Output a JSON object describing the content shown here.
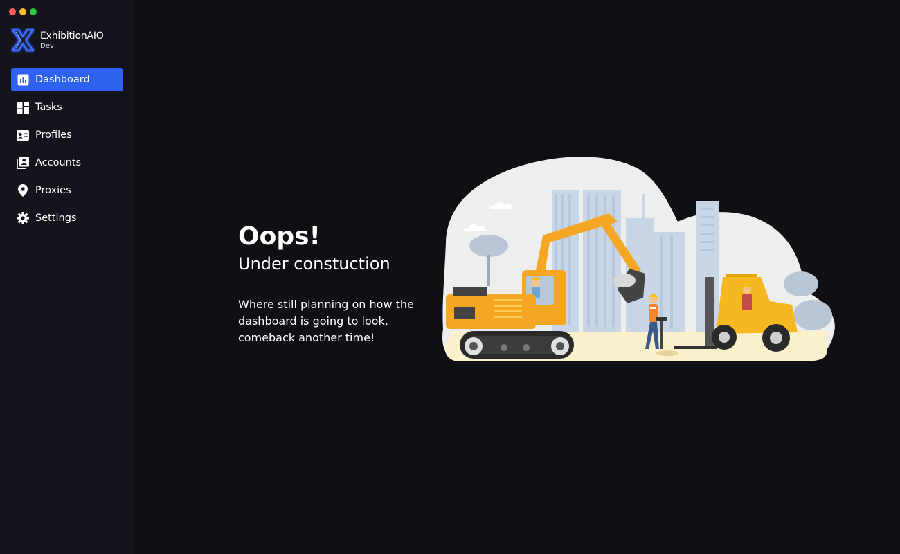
{
  "window": {
    "controls": [
      "close",
      "minimize",
      "zoom"
    ]
  },
  "brand": {
    "name": "ExhibitionAIO",
    "environment": "Dev",
    "logo_icon": "x-logo-icon",
    "accent": "#2f63ef"
  },
  "sidebar": {
    "items": [
      {
        "label": "Dashboard",
        "icon": "bar-chart-icon",
        "active": true
      },
      {
        "label": "Tasks",
        "icon": "dashboard-grid-icon",
        "active": false
      },
      {
        "label": "Profiles",
        "icon": "id-card-icon",
        "active": false
      },
      {
        "label": "Accounts",
        "icon": "contacts-icon",
        "active": false
      },
      {
        "label": "Proxies",
        "icon": "location-pin-icon",
        "active": false
      },
      {
        "label": "Settings",
        "icon": "gear-icon",
        "active": false
      }
    ]
  },
  "main": {
    "title": "Oops!",
    "subtitle": "Under constuction",
    "body": "Where still planning on how the dashboard is going to look, comeback another time!",
    "illustration": "under-construction-illustration"
  }
}
